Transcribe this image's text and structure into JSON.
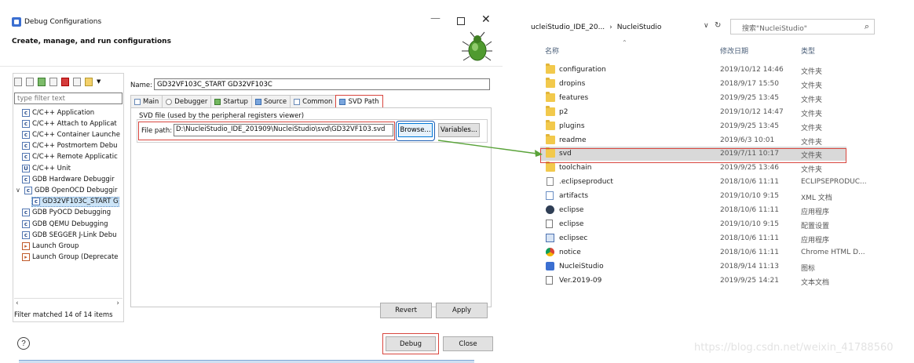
{
  "dialog": {
    "title": "Debug Configurations",
    "heading": "Create, manage, and run configurations",
    "filter_placeholder": "type filter text",
    "tree": [
      {
        "label": "C/C++ Application",
        "icon": "c-launch-icon"
      },
      {
        "label": "C/C++ Attach to Applicat",
        "icon": "c-launch-icon"
      },
      {
        "label": "C/C++ Container Launche",
        "icon": "c-launch-icon"
      },
      {
        "label": "C/C++ Postmortem Debu",
        "icon": "c-launch-icon"
      },
      {
        "label": "C/C++ Remote Applicatic",
        "icon": "c-launch-icon"
      },
      {
        "label": "C/C++ Unit",
        "icon": "cu-icon"
      },
      {
        "label": "GDB Hardware Debuggir",
        "icon": "c-launch-icon"
      },
      {
        "label": "GDB OpenOCD Debuggir",
        "icon": "c-launch-icon",
        "expanded": true
      },
      {
        "label": "GD32VF103C_START G",
        "icon": "c-launch-icon",
        "child": true,
        "selected": true
      },
      {
        "label": "GDB PyOCD Debugging",
        "icon": "c-launch-icon"
      },
      {
        "label": "GDB QEMU Debugging",
        "icon": "c-launch-icon"
      },
      {
        "label": "GDB SEGGER J-Link Debu",
        "icon": "c-launch-icon"
      },
      {
        "label": "Launch Group",
        "icon": "launch-group-icon"
      },
      {
        "label": "Launch Group (Deprecate",
        "icon": "launch-group-deprecated-icon"
      }
    ],
    "filter_status": "Filter matched 14 of 14 items",
    "name_label": "Name:",
    "name_value": "GD32VF103C_START GD32VF103C",
    "tabs": [
      {
        "label": "Main",
        "icon": "main-tab-icon"
      },
      {
        "label": "Debugger",
        "icon": "debugger-tab-icon"
      },
      {
        "label": "Startup",
        "icon": "startup-tab-icon"
      },
      {
        "label": "Source",
        "icon": "source-tab-icon"
      },
      {
        "label": "Common",
        "icon": "common-tab-icon"
      },
      {
        "label": "SVD Path",
        "icon": "svd-tab-icon",
        "active": true
      }
    ],
    "svd_group_label": "SVD file (used by the peripheral registers viewer)",
    "file_path_label": "File path:",
    "file_path_value": "D:\\NucleiStudio_IDE_201909\\NucleiStudio\\svd\\GD32VF103.svd",
    "browse_label": "Browse...",
    "variables_label": "Variables...",
    "revert_label": "Revert",
    "apply_label": "Apply",
    "debug_label": "Debug",
    "close_label": "Close",
    "help_label": "?"
  },
  "explorer": {
    "path": [
      "ucleiStudio_IDE_20...",
      "NucleiStudio"
    ],
    "search_placeholder": "搜索\"NucleiStudio\"",
    "columns": {
      "name": "名称",
      "date": "修改日期",
      "type": "类型"
    },
    "files": [
      {
        "name": "configuration",
        "date": "2019/10/12 14:46",
        "type": "文件夹",
        "icon": "folder-icon"
      },
      {
        "name": "dropins",
        "date": "2018/9/17 15:50",
        "type": "文件夹",
        "icon": "folder-icon"
      },
      {
        "name": "features",
        "date": "2019/9/25 13:45",
        "type": "文件夹",
        "icon": "folder-icon"
      },
      {
        "name": "p2",
        "date": "2019/10/12 14:47",
        "type": "文件夹",
        "icon": "folder-icon"
      },
      {
        "name": "plugins",
        "date": "2019/9/25 13:45",
        "type": "文件夹",
        "icon": "folder-icon"
      },
      {
        "name": "readme",
        "date": "2019/6/3 10:01",
        "type": "文件夹",
        "icon": "folder-icon"
      },
      {
        "name": "svd",
        "date": "2019/7/11 10:17",
        "type": "文件夹",
        "icon": "folder-icon",
        "selected": true
      },
      {
        "name": "toolchain",
        "date": "2019/9/25 13:46",
        "type": "文件夹",
        "icon": "folder-icon"
      },
      {
        "name": ".eclipseproduct",
        "date": "2018/10/6 11:11",
        "type": "ECLIPSEPRODUC...",
        "icon": "file-icon"
      },
      {
        "name": "artifacts",
        "date": "2019/10/10 9:15",
        "type": "XML 文档",
        "icon": "xml-file-icon"
      },
      {
        "name": "eclipse",
        "date": "2018/10/6 11:11",
        "type": "应用程序",
        "icon": "eclipse-exe-icon"
      },
      {
        "name": "eclipse",
        "date": "2019/10/10 9:15",
        "type": "配置设置",
        "icon": "config-file-icon"
      },
      {
        "name": "eclipsec",
        "date": "2018/10/6 11:11",
        "type": "应用程序",
        "icon": "console-exe-icon"
      },
      {
        "name": "notice",
        "date": "2018/10/6 11:11",
        "type": "Chrome HTML D...",
        "icon": "chrome-html-icon"
      },
      {
        "name": "NucleiStudio",
        "date": "2018/9/14 11:13",
        "type": "图标",
        "icon": "nuclei-icon"
      },
      {
        "name": "Ver.2019-09",
        "date": "2019/9/25 14:21",
        "type": "文本文档",
        "icon": "text-file-icon"
      }
    ]
  },
  "watermark": "https://blog.csdn.net/weixin_41788560",
  "colors": {
    "highlight_red": "#d8463e",
    "arrow_green": "#5aa33a",
    "browse_blue": "#1f5fb5",
    "selection": "#cce4f7"
  }
}
